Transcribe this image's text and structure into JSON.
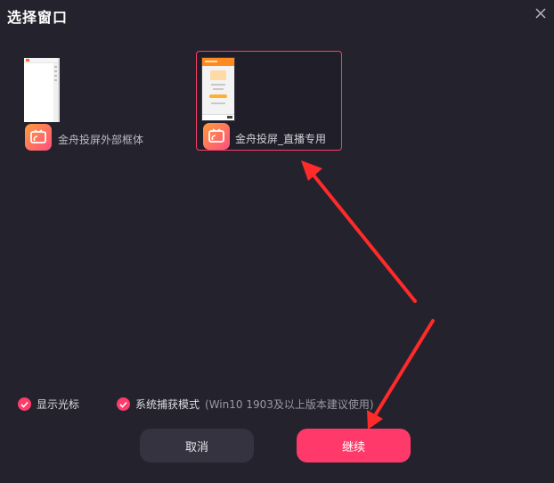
{
  "dialog": {
    "title": "选择窗口",
    "close_icon": "close-icon"
  },
  "windows": [
    {
      "label": "金舟投屏外部框体",
      "icon": "cast-app-icon",
      "selected": false
    },
    {
      "label": "金舟投屏_直播专用",
      "icon": "cast-app-icon",
      "selected": true
    }
  ],
  "options": {
    "show_cursor": {
      "label": "显示光标",
      "checked": true
    },
    "system_capture": {
      "label": "系统捕获模式",
      "hint": "(Win10 1903及以上版本建议使用)",
      "checked": true
    }
  },
  "buttons": {
    "cancel_label": "取消",
    "continue_label": "继续"
  },
  "colors": {
    "background": "#24232d",
    "accent": "#ff3b6b",
    "annotation_arrow": "#ff2a2a"
  }
}
